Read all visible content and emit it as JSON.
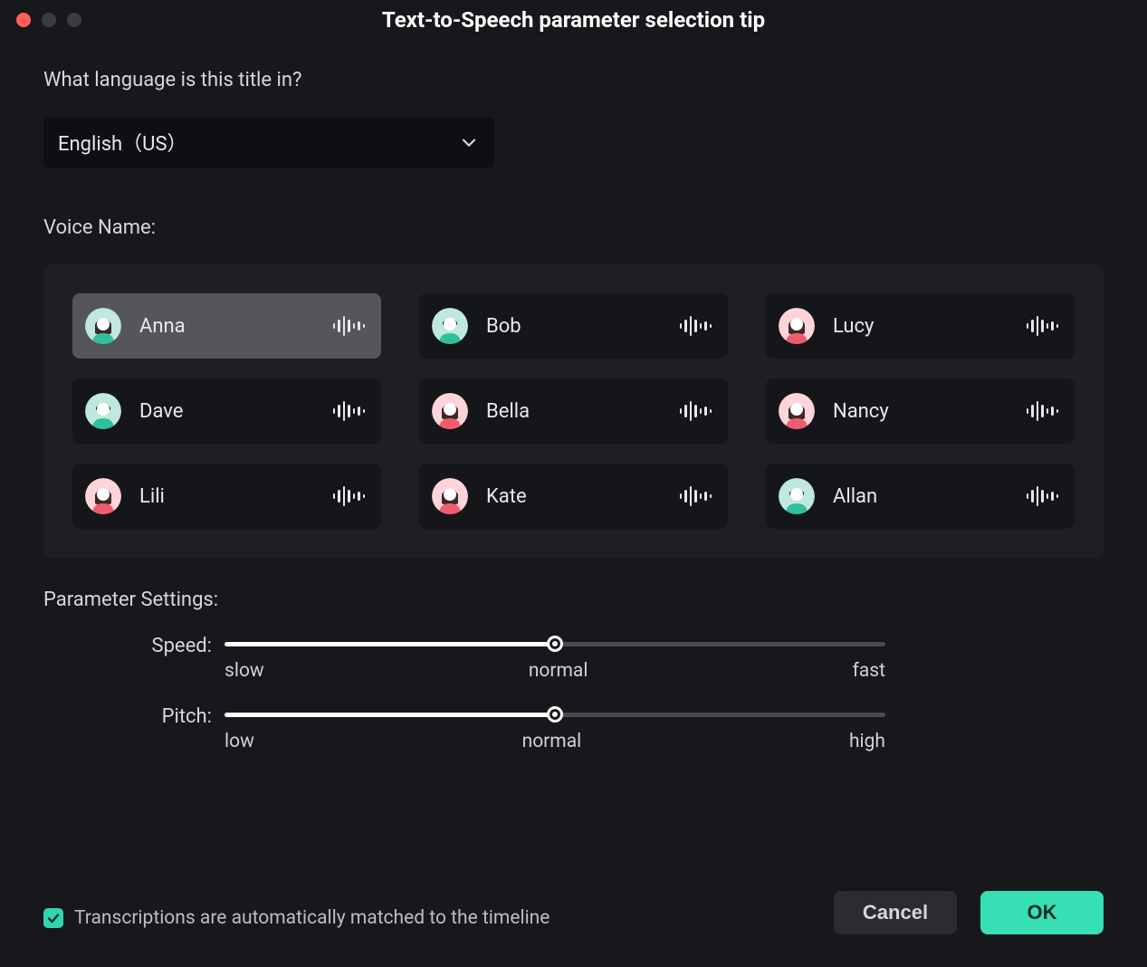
{
  "window": {
    "title": "Text-to-Speech parameter selection tip"
  },
  "language": {
    "prompt": "What language is this title in?",
    "selected": "English（US）"
  },
  "voice": {
    "section_label": "Voice Name:",
    "selected_index": 0,
    "items": [
      {
        "name": "Anna",
        "avatar_color": "teal",
        "gender": "f"
      },
      {
        "name": "Bob",
        "avatar_color": "teal",
        "gender": "m"
      },
      {
        "name": "Lucy",
        "avatar_color": "pink",
        "gender": "f"
      },
      {
        "name": "Dave",
        "avatar_color": "teal",
        "gender": "m"
      },
      {
        "name": "Bella",
        "avatar_color": "coral",
        "gender": "f"
      },
      {
        "name": "Nancy",
        "avatar_color": "coral",
        "gender": "f"
      },
      {
        "name": "Lili",
        "avatar_color": "pink",
        "gender": "f"
      },
      {
        "name": "Kate",
        "avatar_color": "coral",
        "gender": "f"
      },
      {
        "name": "Allan",
        "avatar_color": "teal",
        "gender": "m"
      }
    ]
  },
  "parameters": {
    "section_label": "Parameter Settings:",
    "speed": {
      "label": "Speed:",
      "value": 50,
      "ticks": {
        "low": "slow",
        "mid": "normal",
        "high": "fast"
      }
    },
    "pitch": {
      "label": "Pitch:",
      "value": 50,
      "ticks": {
        "low": "low",
        "mid": "normal",
        "high": "high"
      }
    }
  },
  "footer": {
    "checkbox_checked": true,
    "checkbox_label": "Transcriptions are automatically matched to the timeline",
    "cancel": "Cancel",
    "ok": "OK"
  },
  "colors": {
    "accent": "#36e0b4",
    "avatar_teal_bg": "#bfe8df",
    "avatar_teal_body": "#2fbf9d",
    "avatar_pink_bg": "#ffd4d9",
    "avatar_pink_body": "#f05c6e",
    "avatar_coral_bg": "#ffd4d9",
    "avatar_coral_body": "#f05c6e"
  }
}
